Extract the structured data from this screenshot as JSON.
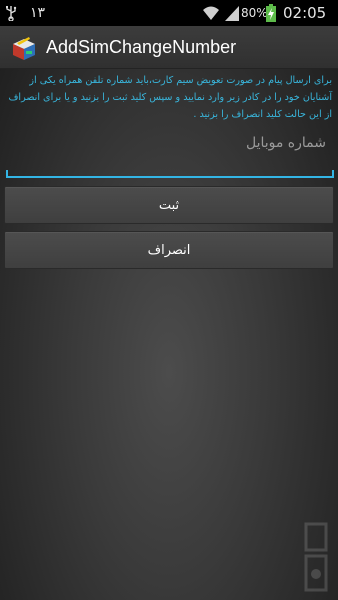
{
  "status_bar": {
    "notification_count": "۱۳",
    "battery_percent": "80%",
    "time": "02:05",
    "icons": [
      "usb-icon",
      "wifi-icon",
      "signal-icon",
      "battery-charging-icon"
    ]
  },
  "action_bar": {
    "title": "AddSimChangeNumber",
    "icon": "app-icon"
  },
  "main": {
    "info_text": "برای ارسال پیام در صورت تعویض سیم کارت،باید شماره تلفن همراه یکی از آشنایان خود را در کادر زیر وارد نمایید و سپس کلید ثبت را بزنید و یا برای انصراف از این حالت کلید انصراف را بزنید .",
    "mobile_input": {
      "value": "",
      "placeholder": "شماره موبایل"
    },
    "submit_label": "ثبت",
    "cancel_label": "انصراف"
  },
  "colors": {
    "accent": "#33b5e5",
    "info_text": "#39b8df",
    "status_bar": "#000000",
    "action_bar": "#363636"
  }
}
